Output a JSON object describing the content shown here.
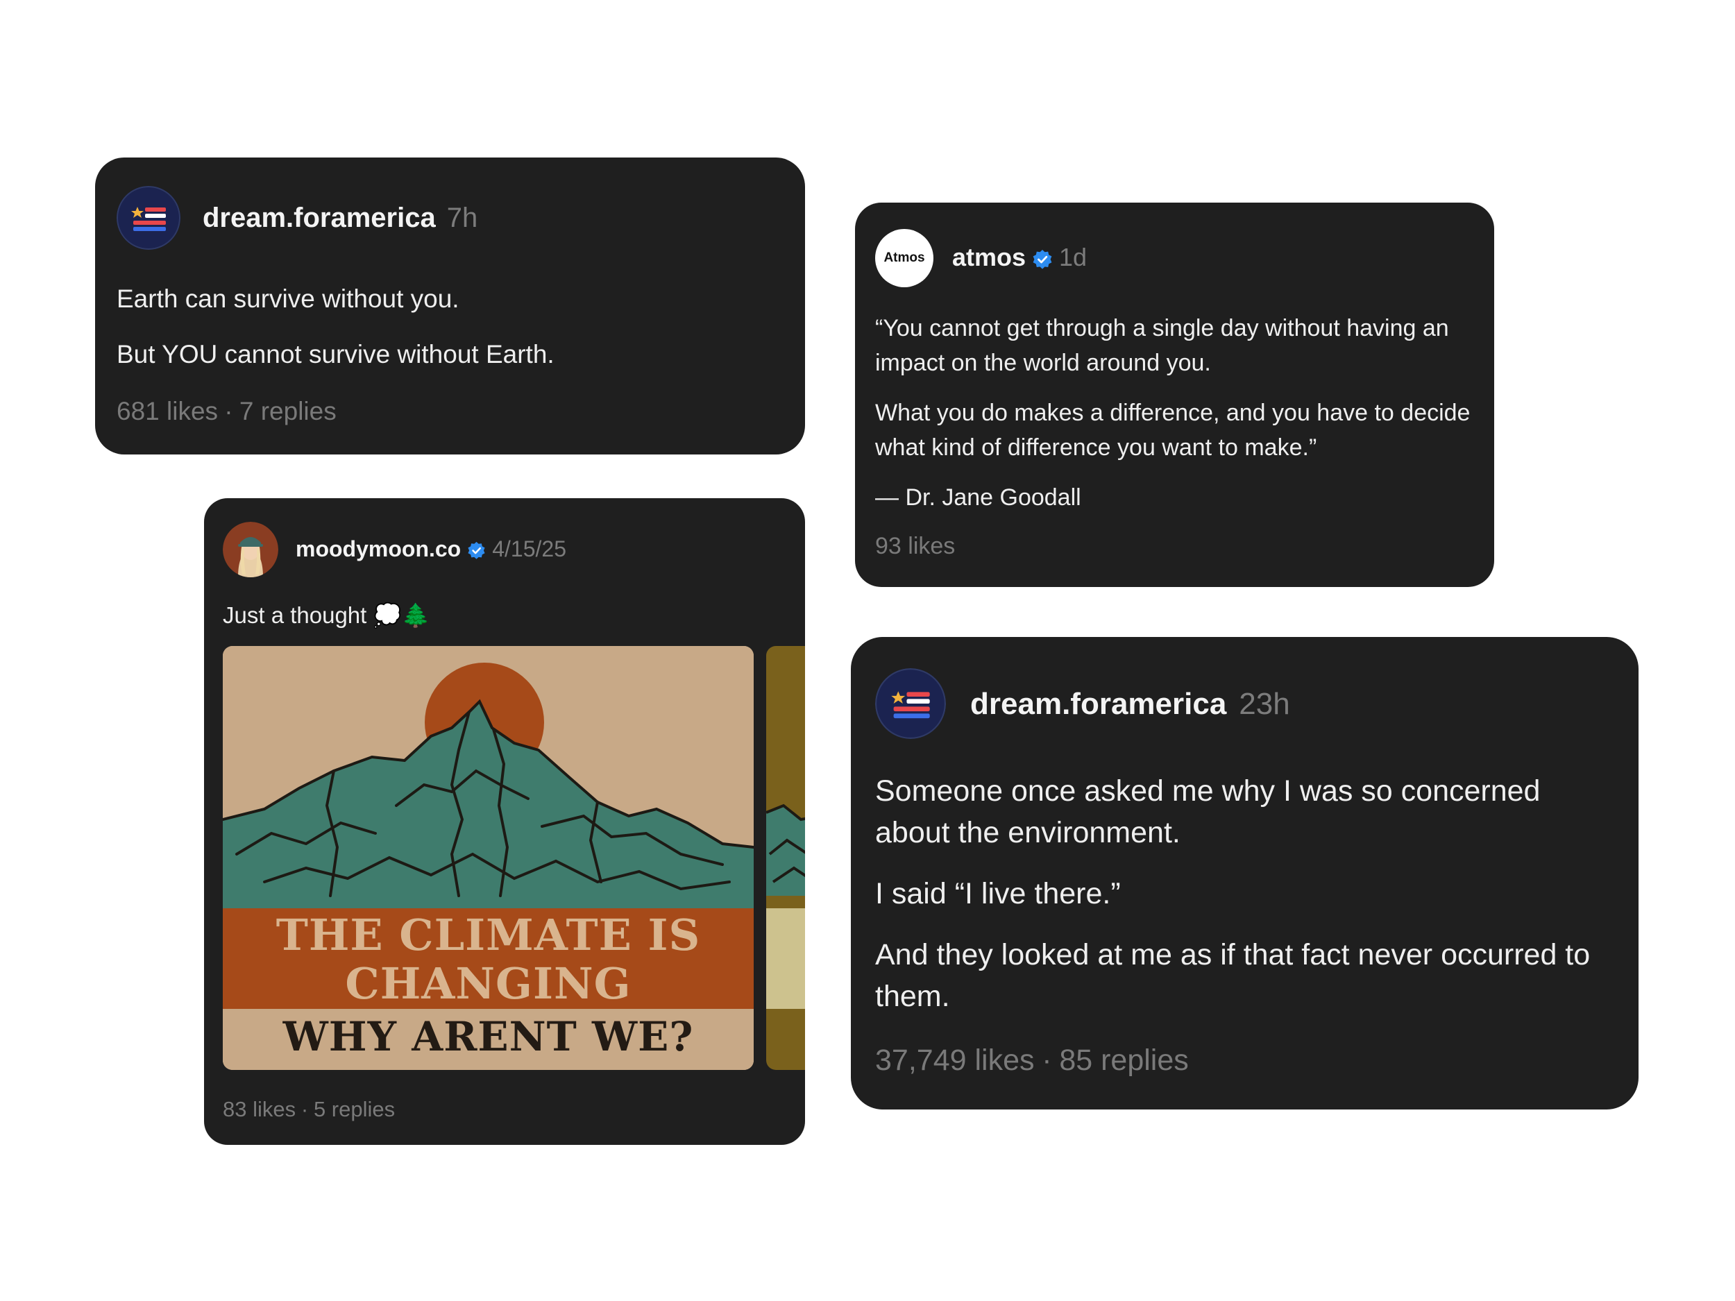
{
  "posts": [
    {
      "username": "dream.foramerica",
      "time": "7h",
      "lines": [
        "Earth can survive without you.",
        "But YOU cannot survive without Earth."
      ],
      "likes": "681 likes",
      "replies": "7 replies"
    },
    {
      "username": "atmos",
      "verified": true,
      "time": "1d",
      "avatar_text": "Atmos",
      "lines": [
        "“You cannot get through a single day without having an impact on the world around you.",
        "What you do makes a difference, and you have to decide what kind of difference you want to make.”",
        "— Dr. Jane Goodall"
      ],
      "likes": "93 likes"
    },
    {
      "username": "moodymoon.co",
      "verified": true,
      "time": "4/15/25",
      "caption": "Just a thought 💭🌲",
      "poster": {
        "line1": "THE CLIMATE IS",
        "line2": "CHANGING",
        "line3": "WHY ARENT WE?"
      },
      "likes": "83 likes",
      "replies": "5 replies"
    },
    {
      "username": "dream.foramerica",
      "time": "23h",
      "lines": [
        "Someone once asked me why I was so concerned about the environment.",
        "I said “I live there.”",
        "And they looked at me as if that fact never occurred to them."
      ],
      "likes": "37,749 likes",
      "replies": "85 replies"
    }
  ],
  "colors": {
    "card_bg": "#1f1f1f",
    "verified_blue": "#2d8cf0",
    "poster_beige": "#c8a987",
    "poster_orange": "#a64a19",
    "poster_teal": "#3f7c6d"
  }
}
